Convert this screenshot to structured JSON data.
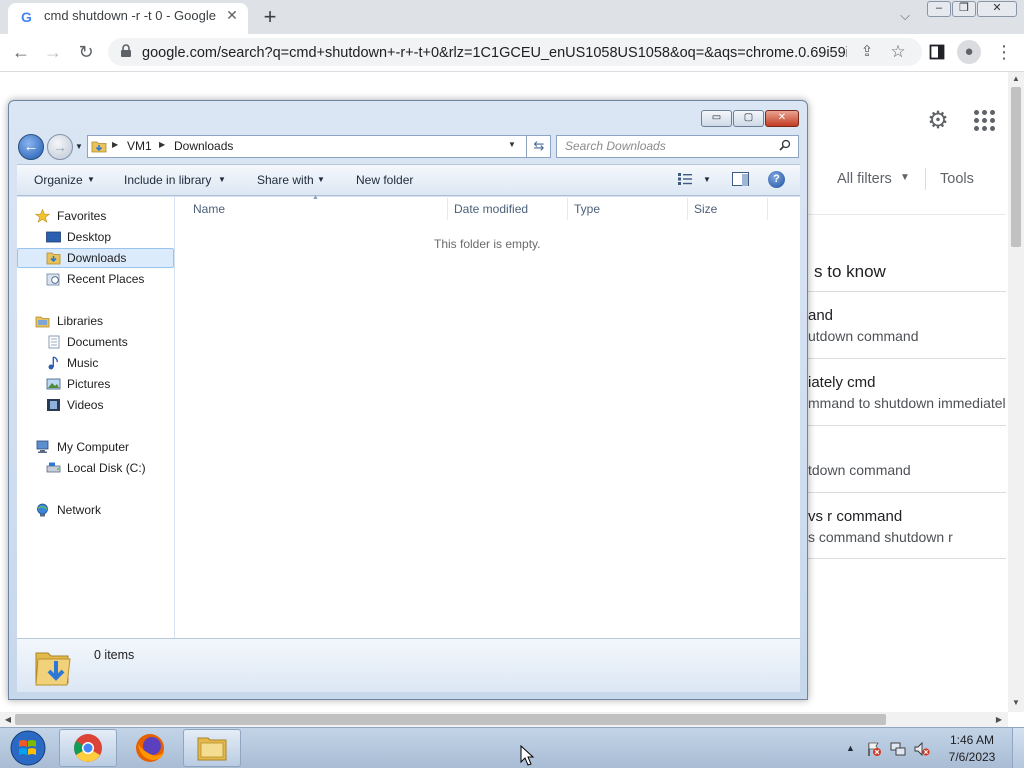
{
  "browser": {
    "tab": {
      "title": "cmd shutdown -r -t 0 - Google S",
      "favicon": "google-g-icon",
      "close_icon": "close-icon"
    },
    "new_tab_icon": "plus-icon",
    "tab_search_icon": "chevron-down-icon",
    "url": "google.com/search?q=cmd+shutdown+-r+-t+0&rlz=1C1GCEU_enUS1058US1058&oq=&aqs=chrome.0.69i59i4...",
    "toolbar_icons": [
      "back-arrow-icon",
      "forward-arrow-icon",
      "reload-icon",
      "lock-icon",
      "share-icon",
      "star-icon",
      "side-panel-icon",
      "profile-icon",
      "kebab-menu-icon"
    ]
  },
  "google": {
    "all_filters": "All filters",
    "tools": "Tools",
    "section_heading": "s to know",
    "results": [
      {
        "title": "and",
        "subtitle": "utdown command"
      },
      {
        "title": "iately cmd",
        "subtitle": "mmand to shutdown immediatel"
      },
      {
        "title": "",
        "subtitle": "tdown command"
      },
      {
        "title": "vs r command",
        "subtitle": "s command shutdown r"
      }
    ]
  },
  "explorer": {
    "caption_buttons": {
      "min": "▭",
      "max": "▢",
      "close": "✕"
    },
    "breadcrumb": [
      "VM1",
      "Downloads"
    ],
    "search_placeholder": "Search Downloads",
    "commands": {
      "organize": "Organize",
      "include_in_library": "Include in library",
      "share_with": "Share with",
      "new_folder": "New folder",
      "help": "?"
    },
    "nav": {
      "favorites": {
        "label": "Favorites",
        "items": [
          "Desktop",
          "Downloads",
          "Recent Places"
        ]
      },
      "libraries": {
        "label": "Libraries",
        "items": [
          "Documents",
          "Music",
          "Pictures",
          "Videos"
        ]
      },
      "computer": {
        "label": "My Computer",
        "items": [
          "Local Disk (C:)"
        ]
      },
      "network": {
        "label": "Network"
      },
      "selected": "Downloads"
    },
    "columns": [
      "Name",
      "Date modified",
      "Type",
      "Size"
    ],
    "empty_message": "This folder is empty.",
    "status": "0 items"
  },
  "taskbar": {
    "apps": [
      "chrome-icon",
      "firefox-icon",
      "windows-explorer-icon"
    ],
    "tray_icons": [
      "action-center-flag-icon",
      "network-icon",
      "volume-muted-icon"
    ],
    "time": "1:46 AM",
    "date": "7/6/2023"
  }
}
